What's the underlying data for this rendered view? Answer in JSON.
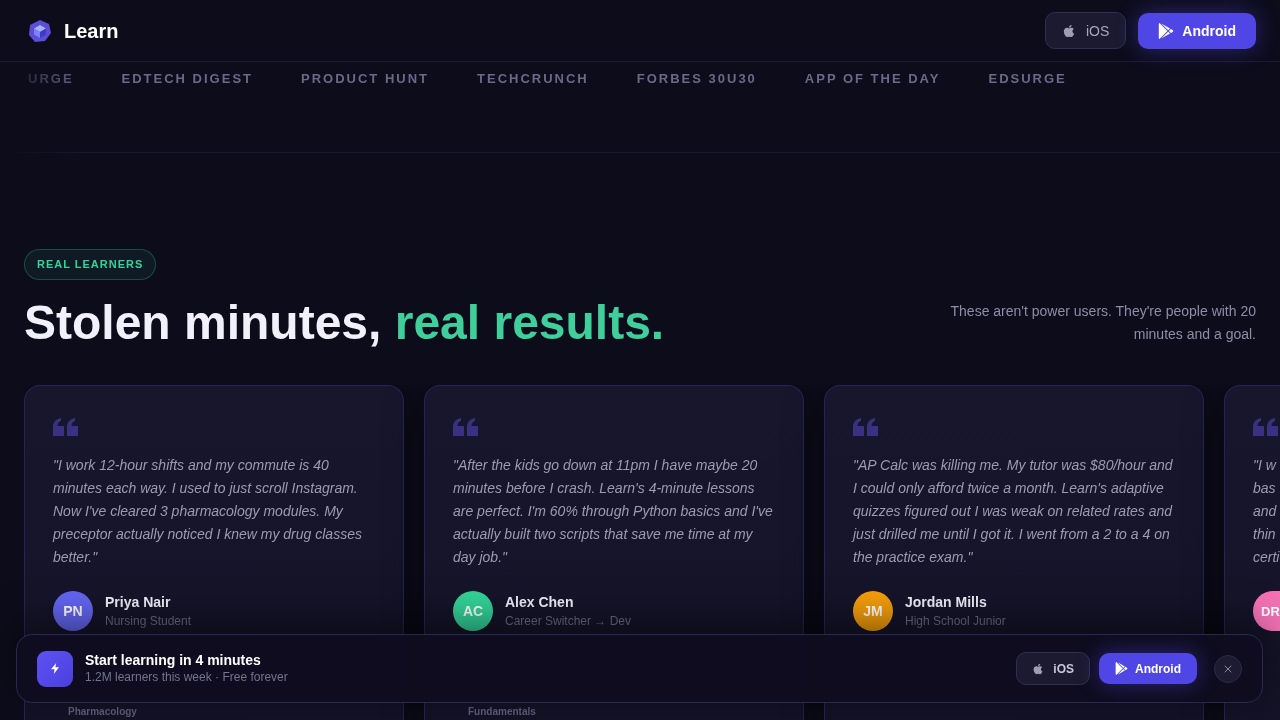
{
  "header": {
    "brand": "Learn",
    "buttons": [
      {
        "kind": "ios",
        "label": "iOS"
      },
      {
        "kind": "android",
        "label": "Android"
      }
    ]
  },
  "press": [
    "URGE",
    "EDTECH DIGEST",
    "PRODUCT HUNT",
    "TECHCRUNCH",
    "FORBES 30U30",
    "APP OF THE DAY",
    "EDSURGE"
  ],
  "section": {
    "badge": "REAL LEARNERS",
    "title": [
      {
        "text": "Stolen minutes,",
        "accent": false
      },
      {
        "text": "real results.",
        "accent": true
      }
    ],
    "description": "These aren't power users. They're people with 20 minutes and a goal."
  },
  "cards": [
    {
      "kind": "full",
      "quote": "\"I work 12-hour shifts and my commute is 40 minutes each way. I used to just scroll Instagram. Now I've cleared 3 pharmacology modules. My preceptor actually noticed I knew my drug classes better.\"",
      "initials": "PN",
      "color": "#6366f1",
      "name": "Priya Nair",
      "role": "Nursing Student",
      "footer": "Pharmacology"
    },
    {
      "kind": "full",
      "quote": "\"After the kids go down at 11pm I have maybe 20 minutes before I crash. Learn's 4-minute lessons are perfect. I'm 60% through Python basics and I've actually built two scripts that save me time at my day job.\"",
      "initials": "AC",
      "color": "#34d399",
      "name": "Alex Chen",
      "role": "Career Switcher → Dev",
      "footer": "Fundamentals"
    },
    {
      "kind": "full",
      "quote": "\"AP Calc was killing me. My tutor was $80/hour and I could only afford twice a month. Learn's adaptive quizzes figured out I was weak on related rates and just drilled me until I got it. I went from a 2 to a 4 on the practice exam.\"",
      "initials": "JM",
      "color": "#f59e0b",
      "name": "Jordan Mills",
      "role": "High School Junior"
    },
    {
      "kind": "partial",
      "quote_lines": [
        "\"I w",
        "bas",
        "and",
        "thin",
        "certi"
      ],
      "initials": "DR",
      "color": "#f472b6"
    }
  ],
  "cta_bar": {
    "title": "Start learning in 4 minutes",
    "subtitle": "1.2M learners this week · Free forever",
    "buttons": [
      {
        "kind": "ios",
        "label": "iOS"
      },
      {
        "kind": "android",
        "label": "Android"
      }
    ]
  }
}
